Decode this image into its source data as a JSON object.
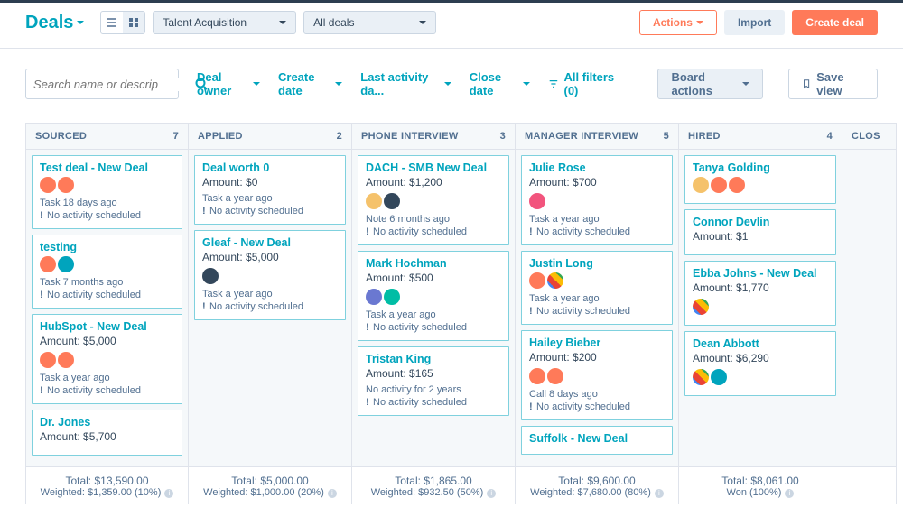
{
  "header": {
    "title": "Deals",
    "pipeline": "Talent Acquisition",
    "dealFilter": "All deals",
    "actions": "Actions",
    "import": "Import",
    "create": "Create deal"
  },
  "filters": {
    "searchPlaceholder": "Search name or descrip",
    "owner": "Deal owner",
    "createDate": "Create date",
    "lastActivity": "Last activity da...",
    "closeDate": "Close date",
    "allFilters": "All filters (0)",
    "boardActions": "Board actions",
    "saveView": "Save view"
  },
  "columns": [
    {
      "name": "SOURCED",
      "count": "7",
      "total": "Total: $13,590.00",
      "weighted": "Weighted: $1,359.00 (10%)",
      "cards": [
        {
          "name": "Test deal - New Deal",
          "amount": "",
          "av": [
            "o",
            "o"
          ],
          "line1": "Task 18 days ago",
          "line2": "No activity scheduled"
        },
        {
          "name": "testing",
          "amount": "",
          "av": [
            "o",
            "b"
          ],
          "line1": "Task 7 months ago",
          "line2": "No activity scheduled"
        },
        {
          "name": "HubSpot - New Deal",
          "amount": "Amount: $5,000",
          "av": [
            "o",
            "o"
          ],
          "line1": "Task a year ago",
          "line2": "No activity scheduled"
        },
        {
          "name": "Dr. Jones",
          "amount": "Amount: $5,700",
          "av": [],
          "line1": "",
          "line2": ""
        }
      ]
    },
    {
      "name": "APPLIED",
      "count": "2",
      "total": "Total: $5,000.00",
      "weighted": "Weighted: $1,000.00 (20%)",
      "cards": [
        {
          "name": "Deal worth 0",
          "amount": "Amount: $0",
          "av": [],
          "line1": "Task a year ago",
          "line2": "No activity scheduled"
        },
        {
          "name": "Gleaf - New Deal",
          "amount": "Amount: $5,000",
          "av": [
            "dk"
          ],
          "line1": "Task a year ago",
          "line2": "No activity scheduled"
        }
      ]
    },
    {
      "name": "PHONE INTERVIEW",
      "count": "3",
      "total": "Total: $1,865.00",
      "weighted": "Weighted: $932.50 (50%)",
      "cards": [
        {
          "name": "DACH - SMB New Deal",
          "amount": "Amount: $1,200",
          "av": [
            "y",
            "dk"
          ],
          "line1": "Note 6 months ago",
          "line2": "No activity scheduled"
        },
        {
          "name": "Mark Hochman",
          "amount": "Amount: $500",
          "av": [
            "pp",
            "g"
          ],
          "line1": "Task a year ago",
          "line2": "No activity scheduled"
        },
        {
          "name": "Tristan King",
          "amount": "Amount: $165",
          "av": [],
          "line1": "No activity for 2 years",
          "line2": "No activity scheduled"
        }
      ]
    },
    {
      "name": "MANAGER INTERVIEW",
      "count": "5",
      "total": "Total: $9,600.00",
      "weighted": "Weighted: $7,680.00 (80%)",
      "cards": [
        {
          "name": "Julie Rose",
          "amount": "Amount: $700",
          "av": [
            "p"
          ],
          "line1": "Task a year ago",
          "line2": "No activity scheduled"
        },
        {
          "name": "Justin Long",
          "amount": "",
          "av": [
            "o",
            "gl"
          ],
          "line1": "Task a year ago",
          "line2": "No activity scheduled"
        },
        {
          "name": "Hailey Bieber",
          "amount": "Amount: $200",
          "av": [
            "o",
            "o"
          ],
          "line1": "Call 8 days ago",
          "line2": "No activity scheduled"
        },
        {
          "name": "Suffolk - New Deal",
          "amount": "",
          "av": [],
          "line1": "",
          "line2": ""
        }
      ]
    },
    {
      "name": "HIRED",
      "count": "4",
      "total": "Total: $8,061.00",
      "weighted": "Won (100%)",
      "cards": [
        {
          "name": "Tanya Golding",
          "amount": "",
          "av": [
            "y",
            "o",
            "o"
          ],
          "line1": "",
          "line2": ""
        },
        {
          "name": "Connor Devlin",
          "amount": "Amount: $1",
          "av": [],
          "line1": "",
          "line2": ""
        },
        {
          "name": "Ebba Johns - New Deal",
          "amount": "Amount: $1,770",
          "av": [
            "gl"
          ],
          "line1": "",
          "line2": ""
        },
        {
          "name": "Dean Abbott",
          "amount": "Amount: $6,290",
          "av": [
            "gl",
            "b"
          ],
          "line1": "",
          "line2": ""
        }
      ]
    }
  ],
  "lastCol": "CLOS"
}
